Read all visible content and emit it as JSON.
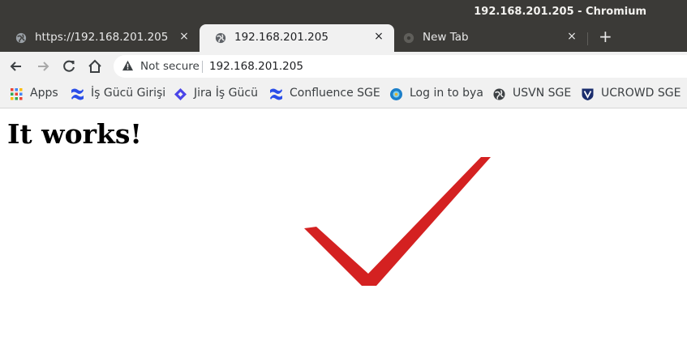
{
  "window": {
    "title": "192.168.201.205 - Chromium"
  },
  "tabs": [
    {
      "label": "https://192.168.201.205",
      "close": "×",
      "active": false,
      "favicon": "globe-icon"
    },
    {
      "label": "192.168.201.205",
      "close": "×",
      "active": true,
      "favicon": "globe-icon"
    },
    {
      "label": "New Tab",
      "close": "×",
      "active": false,
      "favicon": "chromium-icon"
    }
  ],
  "new_tab_button": "+",
  "address_bar": {
    "security_label": "Not secure",
    "url": "192.168.201.205"
  },
  "bookmarks": [
    {
      "label": "Apps",
      "icon": "apps-grid-icon"
    },
    {
      "label": "İş Gücü Girişi",
      "icon": "confluence-icon"
    },
    {
      "label": "Jira İş Gücü",
      "icon": "jira-icon"
    },
    {
      "label": "Confluence SGE",
      "icon": "confluence-icon"
    },
    {
      "label": "Log in to bya",
      "icon": "bya-icon"
    },
    {
      "label": "USVN SGE",
      "icon": "globe-icon"
    },
    {
      "label": "UCROWD SGE",
      "icon": "ucrowd-shield-icon"
    }
  ],
  "page": {
    "heading": "It works!",
    "checkmark_color": "#d42121"
  },
  "colors": {
    "confluence_blue": "#2a4ee8",
    "jira_blue": "#4a45e8",
    "warning": "#3c4043"
  }
}
